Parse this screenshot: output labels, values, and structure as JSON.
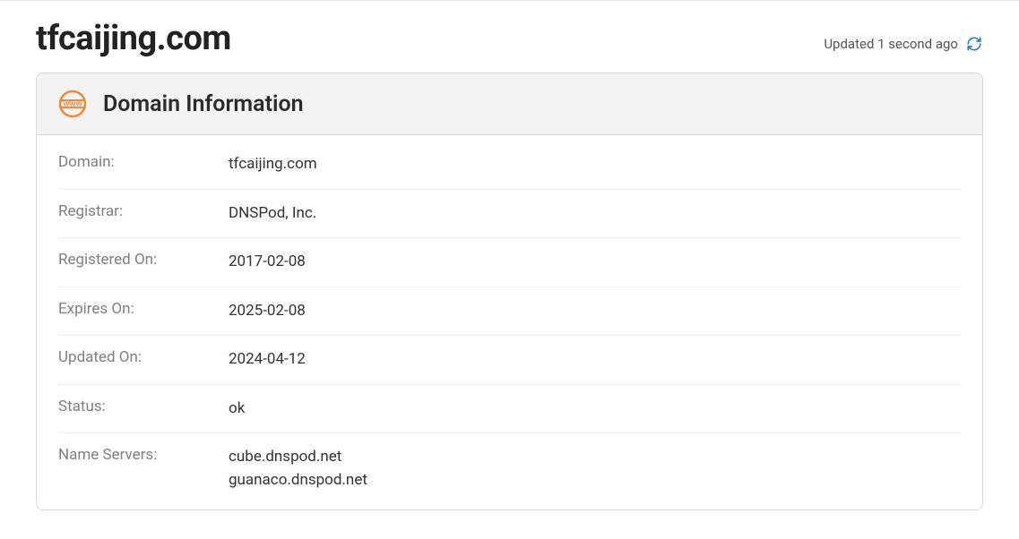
{
  "header": {
    "domain_title": "tfcaijing.com",
    "updated_text": "Updated 1 second ago"
  },
  "card": {
    "title": "Domain Information",
    "rows": [
      {
        "label": "Domain:",
        "value": "tfcaijing.com"
      },
      {
        "label": "Registrar:",
        "value": "DNSPod, Inc."
      },
      {
        "label": "Registered On:",
        "value": "2017-02-08"
      },
      {
        "label": "Expires On:",
        "value": "2025-02-08"
      },
      {
        "label": "Updated On:",
        "value": "2024-04-12"
      },
      {
        "label": "Status:",
        "value": "ok"
      },
      {
        "label": "Name Servers:",
        "value": "cube.dnspod.net\nguanaco.dnspod.net"
      }
    ]
  }
}
